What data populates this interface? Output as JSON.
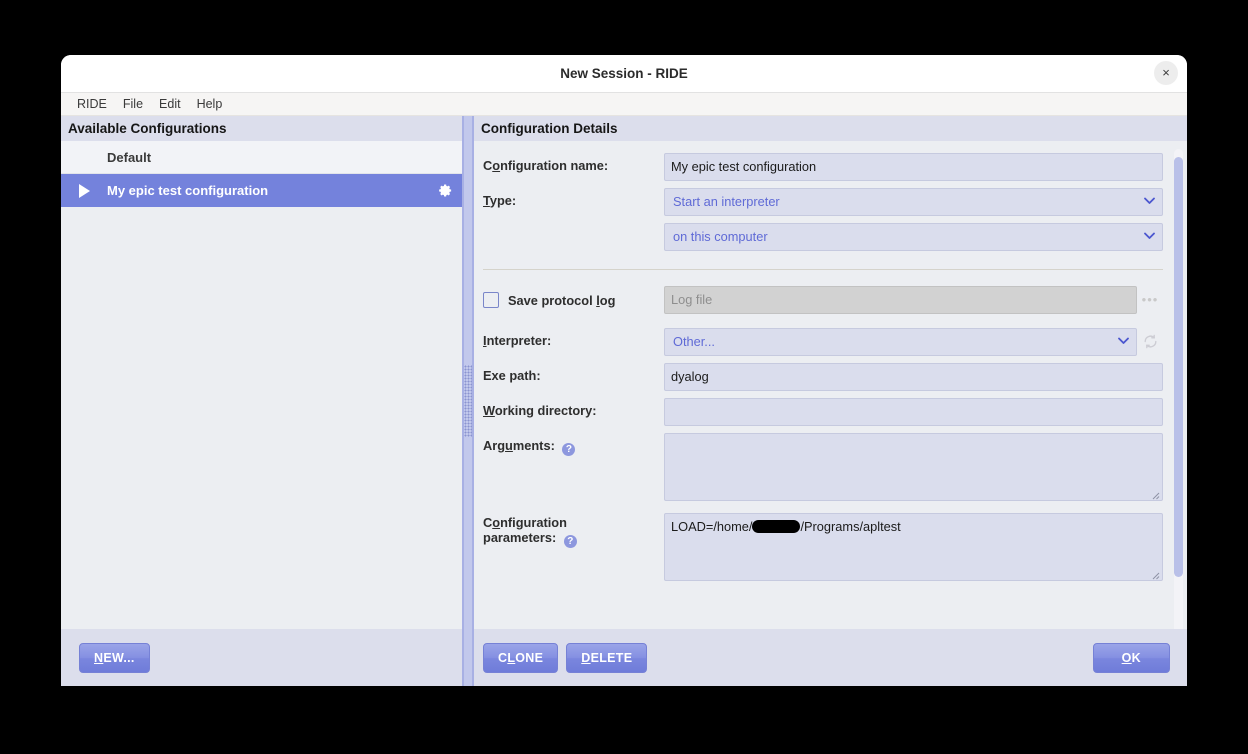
{
  "window": {
    "title": "New Session - RIDE",
    "close_icon": "close-icon",
    "close_glyph": "×"
  },
  "menubar": {
    "items": [
      {
        "label": "RIDE"
      },
      {
        "label": "File"
      },
      {
        "label": "Edit"
      },
      {
        "label": "Help"
      }
    ]
  },
  "left_pane": {
    "header": "Available Configurations",
    "items": [
      {
        "label": "Default",
        "selected": false,
        "marker": "",
        "gear": false
      },
      {
        "label": "My epic test configuration",
        "selected": true,
        "marker": "play-icon",
        "gear": true
      }
    ],
    "new_button": "NEW..."
  },
  "details": {
    "header": "Configuration Details",
    "config_name": {
      "label_pre": "C",
      "label_acc": "o",
      "label_post": "nfiguration name:",
      "value": "My epic test configuration"
    },
    "type": {
      "label_pre": "",
      "label_acc": "T",
      "label_post": "ype:",
      "value": "Start an interpreter",
      "value2": "on this computer",
      "chevron": "⌄"
    },
    "save_log": {
      "label_pre": "Save protocol ",
      "label_acc": "l",
      "label_post": "og",
      "checked": false,
      "log_placeholder": "Log file",
      "log_value": "",
      "browse_label": "•••"
    },
    "interpreter": {
      "label_pre": "",
      "label_acc": "I",
      "label_post": "nterpreter:",
      "value": "Other...",
      "refresh_icon": "refresh-icon"
    },
    "exe_path": {
      "label": "Exe path:",
      "value": "dyalog"
    },
    "working_dir": {
      "label_pre": "",
      "label_acc": "W",
      "label_post": "orking directory:",
      "value": ""
    },
    "arguments": {
      "label_pre": "Arg",
      "label_acc": "u",
      "label_post": "ments:",
      "value": "",
      "help": "?"
    },
    "config_params": {
      "label_pre": "C",
      "label_acc": "o",
      "label_post": "nfiguration",
      "label_line2": "parameters:",
      "value_before": "LOAD=/home/",
      "value_after": "/Programs/apltest",
      "help": "?"
    },
    "buttons": {
      "clone_pre": "C",
      "clone_acc": "L",
      "clone_post": "ONE",
      "clone": "CLONE",
      "delete_acc": "D",
      "delete_post": "ELETE",
      "ok_acc": "O",
      "ok_post": "K"
    }
  },
  "colors": {
    "accent": "#7482dc",
    "select_text": "#5f6ad6",
    "field_bg": "#dadded",
    "panel_bg": "#eceef2",
    "header_bg": "#dcdeec"
  }
}
